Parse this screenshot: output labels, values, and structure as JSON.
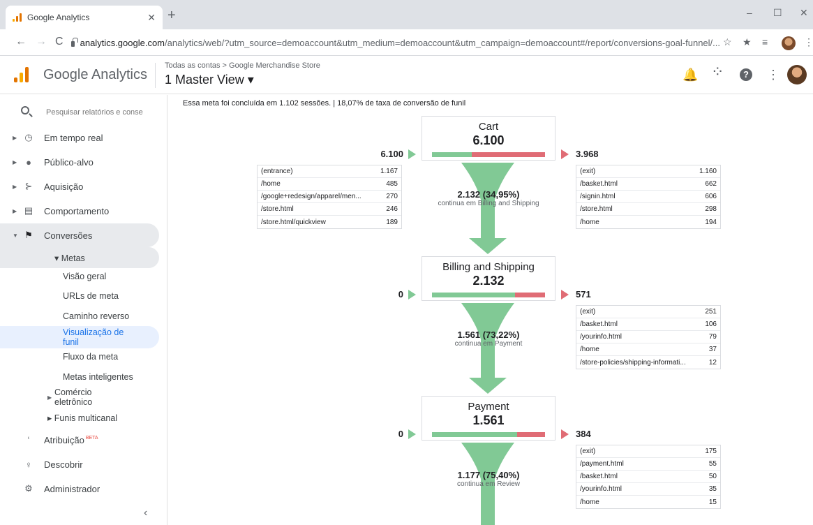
{
  "browser": {
    "tab_title": "Google Analytics",
    "tab_close": "✕",
    "new_tab": "+",
    "url_host": "analytics.google.com",
    "url_rest": "/analytics/web/?utm_source=demoaccount&utm_medium=demoaccount&utm_campaign=demoaccount#/report/conversions-goal-funnel/...",
    "window_controls": [
      "–",
      "☐",
      "✕"
    ],
    "nav": {
      "back": "←",
      "forward": "→",
      "reload": "C"
    },
    "toolbar_icons": {
      "star": "☆",
      "extensions": "★",
      "reading_list": "≡",
      "menu": "⋮"
    }
  },
  "header": {
    "product_name": "Google Analytics",
    "breadcrumb": "Todas as contas > Google Merchandise Store",
    "view_selector": "1 Master View ▾",
    "icons": {
      "notifications": "🔔",
      "apps": "⁘",
      "help": "?",
      "more": "⋮"
    },
    "logo_colors": [
      "#f9ab00",
      "#e37400",
      "#e37400"
    ]
  },
  "sidebar": {
    "search_placeholder": "Pesquisar relatórios e conse",
    "items": [
      {
        "label": "Em tempo real",
        "icon": "clock-icon"
      },
      {
        "label": "Público-alvo",
        "icon": "person-icon"
      },
      {
        "label": "Aquisição",
        "icon": "acquisition-icon"
      },
      {
        "label": "Comportamento",
        "icon": "behavior-icon"
      },
      {
        "label": "Conversões",
        "icon": "flag-icon"
      }
    ],
    "metas_label": "▾ Metas",
    "metas_sub": [
      "Visão geral",
      "URLs de meta",
      "Caminho reverso",
      "Visualização de funil",
      "Fluxo da meta",
      "Metas inteligentes"
    ],
    "ecommerce_label": "Comércio eletrônico",
    "multichannel_label": "▸ Funis multicanal",
    "bottom_items": [
      {
        "label": "Atribuição",
        "badge": "BETA",
        "icon": "attribution-icon"
      },
      {
        "label": "Descobrir",
        "icon": "lightbulb-icon"
      },
      {
        "label": "Administrador",
        "icon": "gear-icon"
      }
    ],
    "collapse": "‹"
  },
  "report": {
    "summary": "Essa meta foi concluída em 1.102 sessões. | 18,07% de taxa de conversão de funil",
    "colors": {
      "proceed": "#81c995",
      "exit": "#e06c75"
    },
    "steps": [
      {
        "name": "Cart",
        "value": "6.100",
        "entrances": "6.100",
        "exits": "3.968",
        "proceed_fraction": 0.3495,
        "entrance_pages": [
          {
            "page": "(entrance)",
            "value": "1.167"
          },
          {
            "page": "/home",
            "value": "485"
          },
          {
            "page": "/google+redesign/apparel/men...",
            "value": "270"
          },
          {
            "page": "/store.html",
            "value": "246"
          },
          {
            "page": "/store.html/quickview",
            "value": "189"
          }
        ],
        "exit_pages": [
          {
            "page": "(exit)",
            "value": "1.160"
          },
          {
            "page": "/basket.html",
            "value": "662"
          },
          {
            "page": "/signin.html",
            "value": "606"
          },
          {
            "page": "/store.html",
            "value": "298"
          },
          {
            "page": "/home",
            "value": "194"
          }
        ],
        "continue_count": "2.132 (34,95%)",
        "continue_text": "continua em Billing and Shipping"
      },
      {
        "name": "Billing and Shipping",
        "value": "2.132",
        "entrances": "0",
        "exits": "571",
        "proceed_fraction": 0.7322,
        "exit_pages": [
          {
            "page": "(exit)",
            "value": "251"
          },
          {
            "page": "/basket.html",
            "value": "106"
          },
          {
            "page": "/yourinfo.html",
            "value": "79"
          },
          {
            "page": "/home",
            "value": "37"
          },
          {
            "page": "/store-policies/shipping-informati...",
            "value": "12"
          }
        ],
        "continue_count": "1.561 (73,22%)",
        "continue_text": "continua em Payment"
      },
      {
        "name": "Payment",
        "value": "1.561",
        "entrances": "0",
        "exits": "384",
        "proceed_fraction": 0.754,
        "exit_pages": [
          {
            "page": "(exit)",
            "value": "175"
          },
          {
            "page": "/payment.html",
            "value": "55"
          },
          {
            "page": "/basket.html",
            "value": "50"
          },
          {
            "page": "/yourinfo.html",
            "value": "35"
          },
          {
            "page": "/home",
            "value": "15"
          }
        ],
        "continue_count": "1.177 (75,40%)",
        "continue_text": "continua em Review"
      }
    ]
  }
}
